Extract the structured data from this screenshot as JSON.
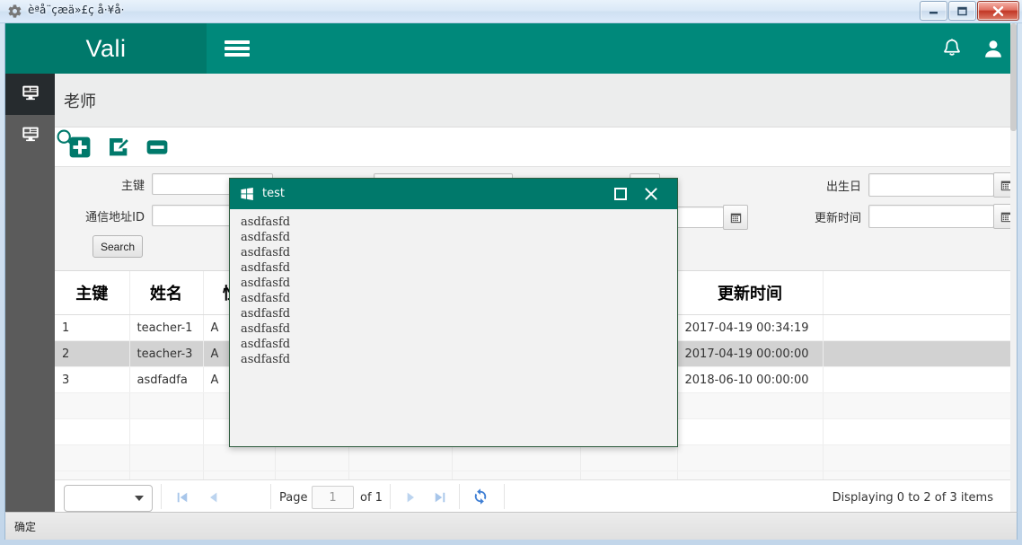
{
  "os_window": {
    "title": "èªå¨çæä»£ç å·¥å·",
    "icon": "gear-icon",
    "minimize_label": "Minimize",
    "maximize_label": "Maximize",
    "close_label": "Close"
  },
  "topbar": {
    "brand": "Vali",
    "menu_icon": "hamburger-icon",
    "bell_icon": "bell-icon",
    "user_icon": "user-icon",
    "accent_color": "#00897b",
    "brand_color": "#00796b"
  },
  "sidebar": {
    "items": [
      {
        "icon": "display-window-icon",
        "active": true
      },
      {
        "icon": "display-window-icon",
        "active": false
      }
    ]
  },
  "page": {
    "title": "老师"
  },
  "toolbar": {
    "add_label": "add-icon",
    "edit_label": "edit-icon",
    "delete_label": "delete-icon",
    "search_label": "search-icon",
    "icon_color": "#00796b"
  },
  "search_form": {
    "fields": [
      {
        "label": "主键",
        "value": "",
        "has_calendar": false
      },
      {
        "label": "通信地址ID",
        "value": "",
        "has_calendar": false
      },
      {
        "label": "出生日",
        "value": "",
        "has_calendar": true
      },
      {
        "label": "更新时间",
        "value": "",
        "has_calendar": true
      }
    ],
    "search_button": "Search"
  },
  "grid": {
    "columns": [
      "主键",
      "姓名",
      "性别",
      "",
      "",
      "",
      "",
      "更新时间",
      ""
    ],
    "rows": [
      {
        "cells": [
          "1",
          "teacher-1",
          "A",
          "",
          "",
          "",
          "",
          "2017-04-19 00:34:19",
          ""
        ],
        "selected": false
      },
      {
        "cells": [
          "2",
          "teacher-3",
          "A",
          "",
          "",
          "",
          "",
          "2017-04-19 00:00:00",
          ""
        ],
        "selected": true
      },
      {
        "cells": [
          "3",
          "asdfadfa",
          "A",
          "",
          "",
          "",
          "",
          "2018-06-10 00:00:00",
          ""
        ],
        "selected": false
      }
    ],
    "empty_row_count": 4,
    "selected_row_color": "#d2d2d2"
  },
  "pager": {
    "page_size_value": "",
    "first_icon": "first-page-icon",
    "prev_icon": "prev-page-icon",
    "next_icon": "next-page-icon",
    "last_icon": "last-page-icon",
    "refresh_icon": "refresh-icon",
    "page_label": "Page",
    "page_number": "1",
    "of_label": "of 1",
    "info": "Displaying 0 to 2 of 3 items",
    "nav_color": "#a8c6ea",
    "refresh_color": "#3f7fd4"
  },
  "statusbar": {
    "text": "确定"
  },
  "dialog": {
    "title": "test",
    "icon": "windows-flag-icon",
    "maximize_label": "Maximize",
    "close_label": "Close",
    "header_color": "#00796b",
    "lines": [
      "asdfasfd",
      "asdfasfd",
      "asdfasfd",
      "asdfasfd",
      "asdfasfd",
      "asdfasfd",
      "asdfasfd",
      "asdfasfd",
      "asdfasfd",
      "asdfasfd"
    ]
  }
}
